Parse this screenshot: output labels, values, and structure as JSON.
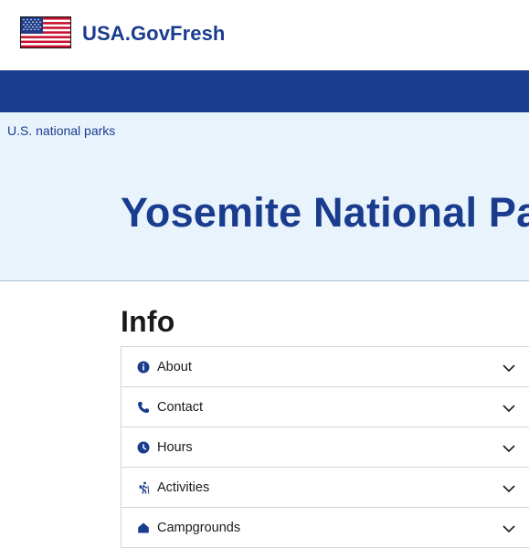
{
  "header": {
    "site_title": "USA.GovFresh",
    "logo_icon": "us-flag-icon"
  },
  "breadcrumb": {
    "label": "U.S. national parks"
  },
  "hero": {
    "title": "Yosemite National Park"
  },
  "info": {
    "heading": "Info",
    "items": [
      {
        "label": "About",
        "icon": "info-circle-icon"
      },
      {
        "label": "Contact",
        "icon": "phone-icon"
      },
      {
        "label": "Hours",
        "icon": "clock-icon"
      },
      {
        "label": "Activities",
        "icon": "hiking-icon"
      },
      {
        "label": "Campgrounds",
        "icon": "campground-icon"
      }
    ]
  },
  "colors": {
    "primary": "#1a3c8f",
    "hero_bg": "#e9f3fc"
  }
}
